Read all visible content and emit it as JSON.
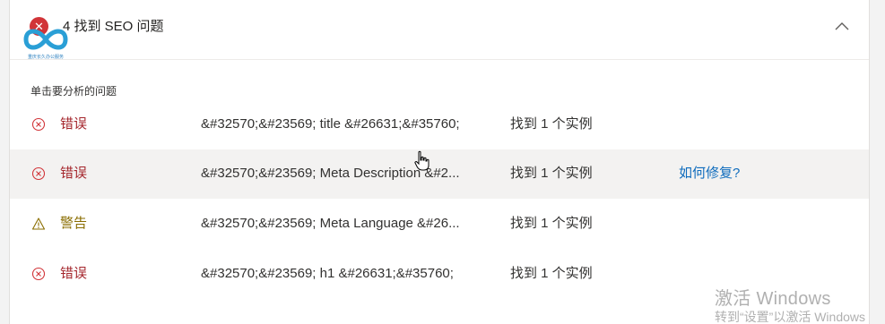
{
  "header": {
    "title": "4 找到 SEO 问题",
    "logo_caption": "重庆长久办公服务"
  },
  "instruction": "单击要分析的问题",
  "issues": [
    {
      "severity": "错误",
      "kind": "error",
      "description": "&#32570;&#23569; title &#26631;&#35760;",
      "count": "找到 1 个实例",
      "link": ""
    },
    {
      "severity": "错误",
      "kind": "error",
      "description": "&#32570;&#23569; Meta Description &#2...",
      "count": "找到 1 个实例",
      "link": "如何修复?"
    },
    {
      "severity": "警告",
      "kind": "warning",
      "description": "&#32570;&#23569; Meta Language &#26...",
      "count": "找到 1 个实例",
      "link": ""
    },
    {
      "severity": "错误",
      "kind": "error",
      "description": "&#32570;&#23569; h1 &#26631;&#35760;",
      "count": "找到 1 个实例",
      "link": ""
    }
  ],
  "watermark": {
    "title": "激活 Windows",
    "subtitle": "转到“设置”以激活 Windows"
  },
  "colors": {
    "error": "#d13438",
    "warning": "#8a6d00",
    "link": "#0f6cbd",
    "highlight_row": "#f3f2f1"
  },
  "icons": {
    "error": "error-circle-icon",
    "warning": "warning-triangle-icon",
    "collapse": "chevron-up-icon"
  }
}
